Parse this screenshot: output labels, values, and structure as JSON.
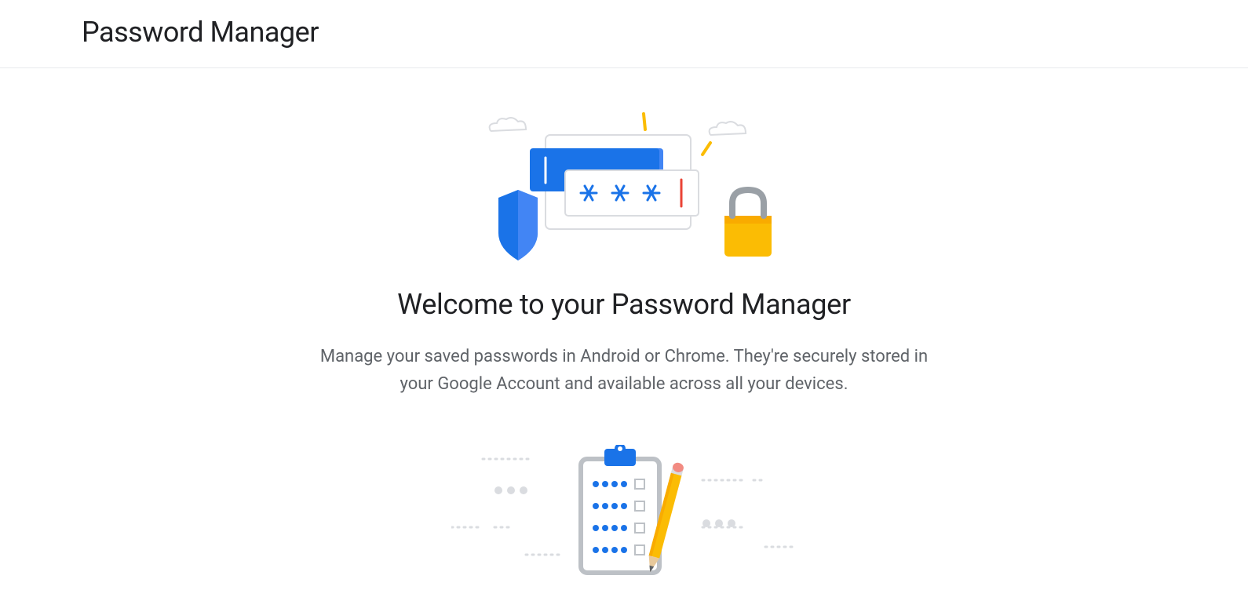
{
  "header": {
    "title": "Password Manager"
  },
  "welcome": {
    "title": "Welcome to your Password Manager",
    "description": "Manage your saved passwords in Android or Chrome. They're securely stored in your Google Account and available across all your devices."
  }
}
